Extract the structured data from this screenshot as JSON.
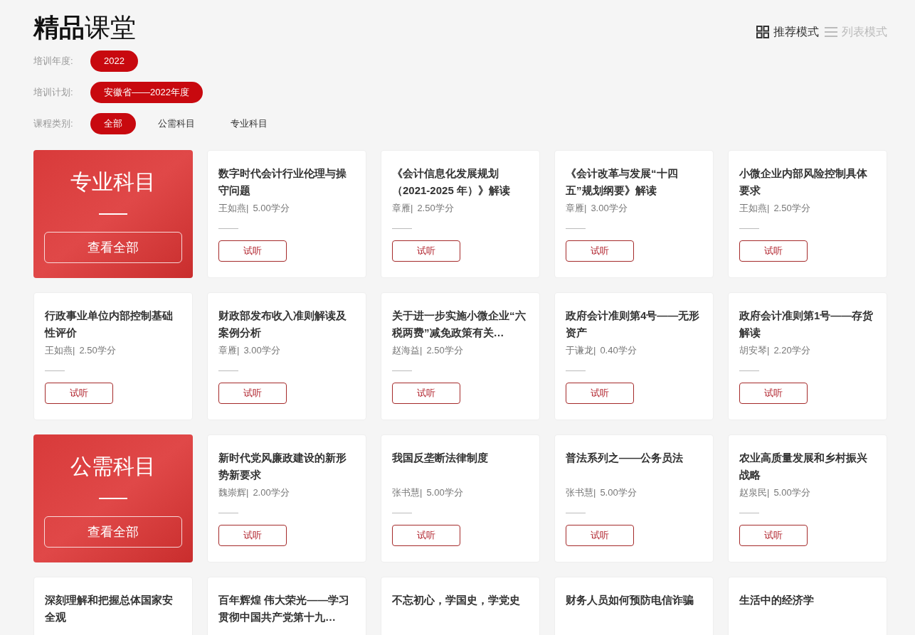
{
  "page_title": "**精品**课堂",
  "view_modes": [
    {
      "label": "推荐模式",
      "kind": "grid",
      "selected": true
    },
    {
      "label": "列表模式",
      "kind": "list",
      "selected": false
    }
  ],
  "filters": [
    {
      "label": "培训年度:",
      "options": [
        {
          "label": "2022",
          "selected": true
        }
      ]
    },
    {
      "label": "培训计划:",
      "options": [
        {
          "label": "安徽省——2022年度",
          "selected": true
        }
      ]
    },
    {
      "label": "课程类别:",
      "options": [
        {
          "label": "全部",
          "selected": true
        },
        {
          "label": "公需科目",
          "selected": false
        },
        {
          "label": "专业科目",
          "selected": false
        }
      ]
    }
  ],
  "sections": [
    {
      "category": {
        "title": "专业科目",
        "button": "查看全部"
      },
      "courses": [
        {
          "title": "数字时代会计行业伦理与操守问题",
          "teacher": "王如燕|",
          "credits": "5.00学分",
          "button": "试听"
        },
        {
          "title": "《会计信息化发展规划（2021-2025 年）》解读",
          "teacher": "章雁|",
          "credits": "2.50学分",
          "button": "试听"
        },
        {
          "title": "《会计改革与发展“十四五”规划纲要》解读",
          "teacher": "章雁|",
          "credits": "3.00学分",
          "button": "试听"
        },
        {
          "title": "小微企业内部风险控制具体要求",
          "teacher": "王如燕|",
          "credits": "2.50学分",
          "button": "试听"
        },
        {
          "title": "行政事业单位内部控制基础性评价",
          "teacher": "王如燕|",
          "credits": "2.50学分",
          "button": "试听"
        },
        {
          "title": "财政部发布收入准则解读及案例分析",
          "teacher": "章雁|",
          "credits": "3.00学分",
          "button": "试听"
        },
        {
          "title": "关于进一步实施小微企业“六税两费”减免政策有关…",
          "teacher": "赵海益|",
          "credits": "2.50学分",
          "button": "试听"
        },
        {
          "title": "政府会计准则第4号——无形资产",
          "teacher": "于谦龙|",
          "credits": "0.40学分",
          "button": "试听"
        },
        {
          "title": "政府会计准则第1号——存货解读",
          "teacher": "胡安琴|",
          "credits": "2.20学分",
          "button": "试听"
        }
      ]
    },
    {
      "category": {
        "title": "公需科目",
        "button": "查看全部"
      },
      "courses": [
        {
          "title": "新时代党风廉政建设的新形势新要求",
          "teacher": "魏崇辉|",
          "credits": "2.00学分",
          "button": "试听"
        },
        {
          "title": "我国反垄断法律制度",
          "teacher": "张书慧|",
          "credits": "5.00学分",
          "button": "试听"
        },
        {
          "title": "普法系列之——公务员法",
          "teacher": "张书慧|",
          "credits": "5.00学分",
          "button": "试听"
        },
        {
          "title": "农业高质量发展和乡村振兴战略",
          "teacher": "赵泉民|",
          "credits": "5.00学分",
          "button": "试听"
        },
        {
          "title": "深刻理解和把握总体国家安全观"
        },
        {
          "title": "百年辉煌 伟大荣光——学习贯彻中国共产党第十九…"
        },
        {
          "title": "不忘初心，学国史，学党史"
        },
        {
          "title": "财务人员如何预防电信诈骗"
        },
        {
          "title": "生活中的经济学"
        }
      ]
    }
  ]
}
